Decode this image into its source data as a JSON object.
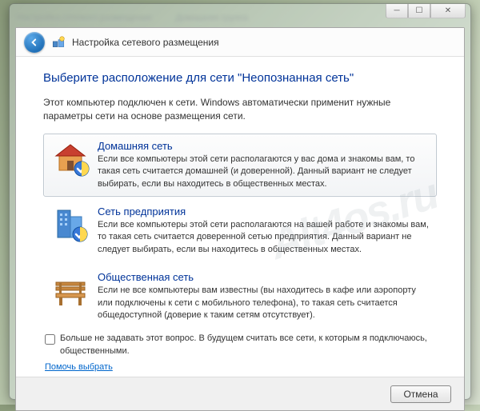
{
  "window": {
    "title": "Настройка сетевого размещения",
    "blur_items": [
      "Настройка сетевого размещения",
      "Домашняя группа"
    ]
  },
  "titlebar_buttons": {
    "min": "─",
    "max": "☐",
    "close": "✕"
  },
  "heading": "Выберите расположение для сети \"Неопознанная сеть\"",
  "intro": "Этот компьютер подключен к сети. Windows автоматически применит нужные параметры сети на основе размещения сети.",
  "options": {
    "home": {
      "title": "Домашняя сеть",
      "desc": "Если все компьютеры этой сети располагаются у вас дома и знакомы вам, то такая сеть считается домашней (и доверенной). Данный вариант не следует выбирать, если вы находитесь в общественных местах."
    },
    "work": {
      "title": "Сеть предприятия",
      "desc": "Если все компьютеры этой сети располагаются на вашей работе и знакомы вам, то такая сеть считается доверенной сетью предприятия. Данный вариант не следует выбирать, если вы находитесь в общественных местах."
    },
    "public": {
      "title": "Общественная сеть",
      "desc": "Если не все компьютеры вам известны (вы находитесь в кафе или аэропорту или подключены к сети с мобильного телефона), то такая сеть считается общедоступной (доверие к таким сетям отсутствует)."
    }
  },
  "remember_label": "Больше не задавать этот вопрос. В будущем считать все сети, к которым я подключаюсь, общественными.",
  "help_link": "Помочь выбрать",
  "cancel_label": "Отмена",
  "watermark": "Alt4os.ru"
}
